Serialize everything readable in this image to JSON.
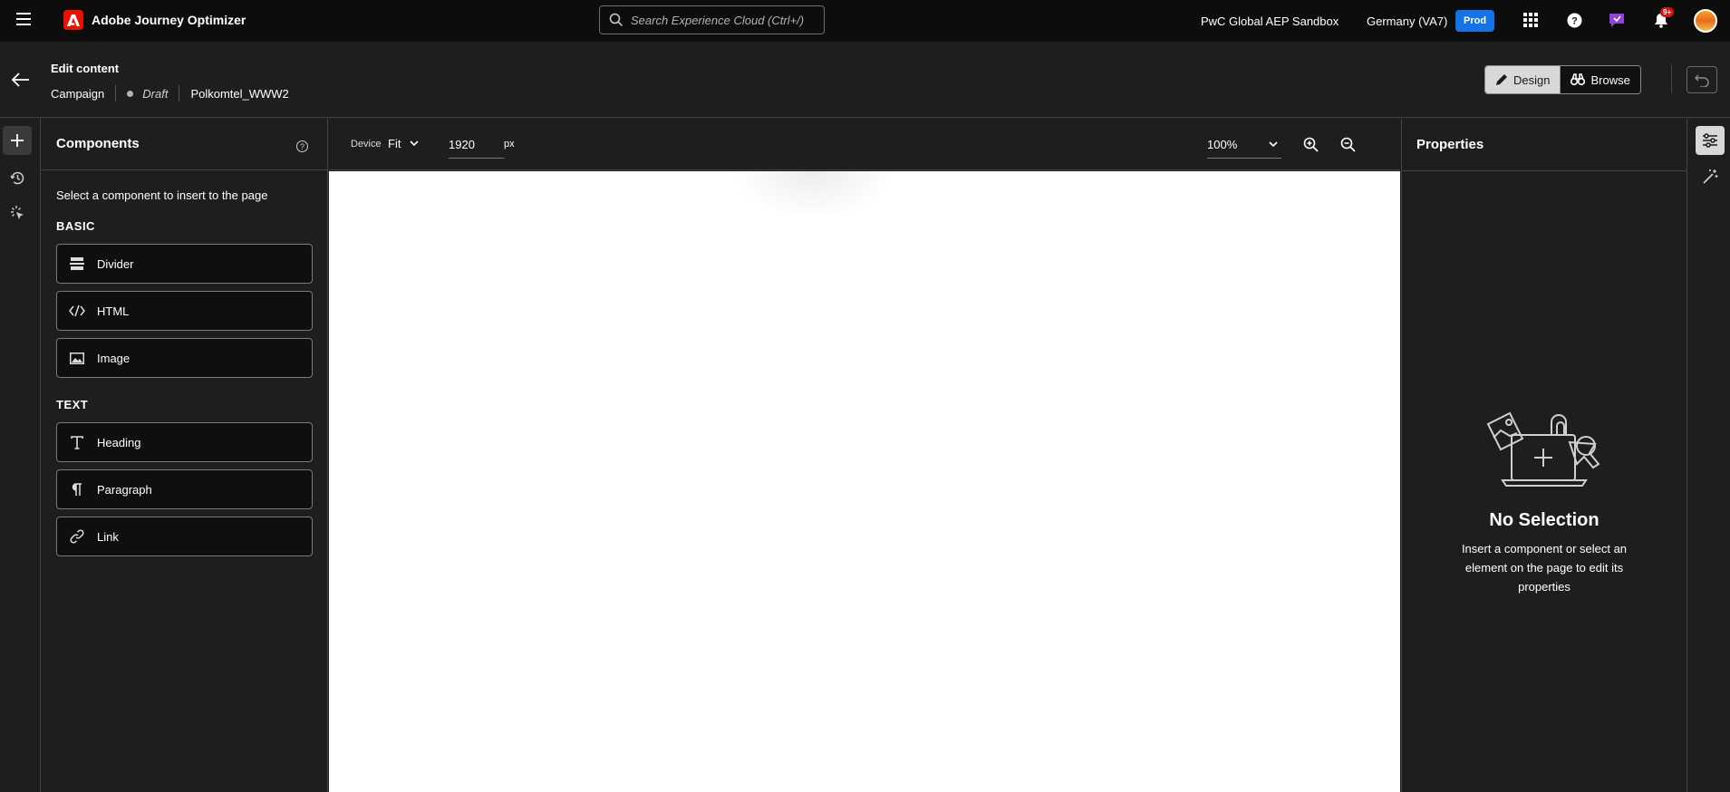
{
  "app": {
    "title": "Adobe Journey Optimizer",
    "search_placeholder": "Search Experience Cloud (Ctrl+/)",
    "sandbox": "PwC Global AEP Sandbox",
    "region": "Germany (VA7)",
    "env_badge": "Prod",
    "notifications_count": "9+"
  },
  "header": {
    "title": "Edit content",
    "breadcrumb": [
      "Campaign",
      "Draft",
      "Polkomtel_WWW2"
    ],
    "mode_design": "Design",
    "mode_browse": "Browse"
  },
  "components_panel": {
    "title": "Components",
    "description": "Select a component to insert to the page",
    "basic_label": "BASIC",
    "basic_items": [
      "Divider",
      "HTML",
      "Image"
    ],
    "text_label": "TEXT",
    "text_items": [
      "Heading",
      "Paragraph",
      "Link"
    ]
  },
  "toolbar": {
    "device_label": "Device",
    "device_value": "Fit",
    "width_value": "1920",
    "width_unit": "px",
    "zoom_value": "100%"
  },
  "properties_panel": {
    "title": "Properties",
    "empty_title": "No Selection",
    "empty_desc": "Insert a component or select an element on the page to edit its properties"
  },
  "colors": {
    "accent": "#1473e6",
    "brand": "#eb1000",
    "badge": "#d31510"
  }
}
